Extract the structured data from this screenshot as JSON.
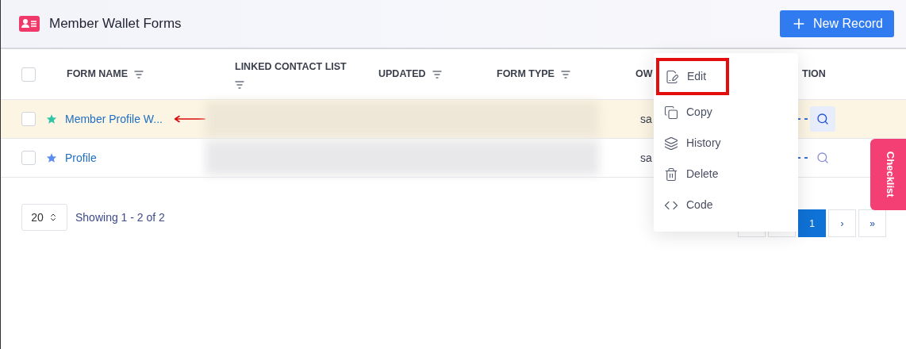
{
  "header": {
    "title": "Member Wallet Forms",
    "new_button": "New Record"
  },
  "table": {
    "columns": [
      {
        "label": "FORM NAME",
        "filter": true
      },
      {
        "label": "LINKED CONTACT LIST",
        "filter": true
      },
      {
        "label": "UPDATED",
        "filter": true
      },
      {
        "label": "FORM TYPE",
        "filter": true
      },
      {
        "label": "OW",
        "filter": false
      },
      {
        "label": "TION",
        "filter": false
      }
    ],
    "select_all": {
      "checked": false
    },
    "rows": [
      {
        "name": "Member Profile W...",
        "color": "#2ec4a6",
        "selected": true,
        "checked": false,
        "owner": "sa",
        "annotated": true
      },
      {
        "name": "Profile",
        "color": "#5b8def",
        "selected": false,
        "checked": false,
        "owner": "sa",
        "annotated": false
      }
    ]
  },
  "menu": {
    "items": [
      {
        "label": "Edit",
        "highlighted": true
      },
      {
        "label": "Copy",
        "highlighted": false
      },
      {
        "label": "History",
        "highlighted": false
      },
      {
        "label": "Delete",
        "highlighted": false
      },
      {
        "label": "Code",
        "highlighted": false
      }
    ]
  },
  "footer": {
    "page_size": "20",
    "showing": "Showing 1 - 2 of 2",
    "pages": [
      {
        "selected": false
      },
      {
        "selected": false
      },
      {
        "label": "1",
        "selected": true
      },
      {
        "label": "›",
        "selected": false
      },
      {
        "label": "»",
        "selected": false
      }
    ]
  },
  "side_tab": "Checklist"
}
